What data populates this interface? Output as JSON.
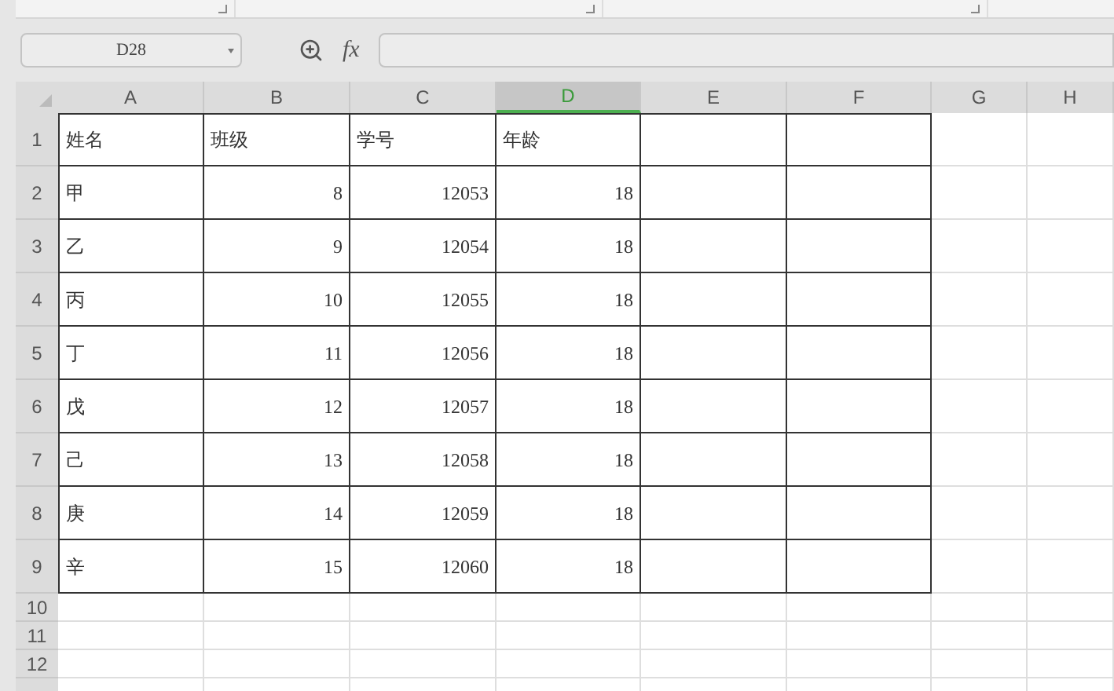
{
  "name_box": {
    "value": "D28"
  },
  "formula_bar": {
    "function_label": "fx"
  },
  "columns": [
    {
      "label": "A",
      "selected": false
    },
    {
      "label": "B",
      "selected": false
    },
    {
      "label": "C",
      "selected": false
    },
    {
      "label": "D",
      "selected": true
    },
    {
      "label": "E",
      "selected": false
    },
    {
      "label": "F",
      "selected": false
    },
    {
      "label": "G",
      "selected": false
    },
    {
      "label": "H",
      "selected": false
    }
  ],
  "rows": [
    {
      "number": "1",
      "cells": [
        {
          "text": "姓名",
          "kind": "text"
        },
        {
          "text": "班级",
          "kind": "text"
        },
        {
          "text": "学号",
          "kind": "text"
        },
        {
          "text": "年龄",
          "kind": "text"
        }
      ]
    },
    {
      "number": "2",
      "cells": [
        {
          "text": "甲",
          "kind": "text"
        },
        {
          "text": "8",
          "kind": "number"
        },
        {
          "text": "12053",
          "kind": "number"
        },
        {
          "text": "18",
          "kind": "number"
        }
      ]
    },
    {
      "number": "3",
      "cells": [
        {
          "text": "乙",
          "kind": "text"
        },
        {
          "text": "9",
          "kind": "number"
        },
        {
          "text": "12054",
          "kind": "number"
        },
        {
          "text": "18",
          "kind": "number"
        }
      ]
    },
    {
      "number": "4",
      "cells": [
        {
          "text": "丙",
          "kind": "text"
        },
        {
          "text": "10",
          "kind": "number"
        },
        {
          "text": "12055",
          "kind": "number"
        },
        {
          "text": "18",
          "kind": "number"
        }
      ]
    },
    {
      "number": "5",
      "cells": [
        {
          "text": "丁",
          "kind": "text"
        },
        {
          "text": "11",
          "kind": "number"
        },
        {
          "text": "12056",
          "kind": "number"
        },
        {
          "text": "18",
          "kind": "number"
        }
      ]
    },
    {
      "number": "6",
      "cells": [
        {
          "text": "戊",
          "kind": "text"
        },
        {
          "text": "12",
          "kind": "number"
        },
        {
          "text": "12057",
          "kind": "number"
        },
        {
          "text": "18",
          "kind": "number"
        }
      ]
    },
    {
      "number": "7",
      "cells": [
        {
          "text": "己",
          "kind": "text"
        },
        {
          "text": "13",
          "kind": "number"
        },
        {
          "text": "12058",
          "kind": "number"
        },
        {
          "text": "18",
          "kind": "number"
        }
      ]
    },
    {
      "number": "8",
      "cells": [
        {
          "text": "庚",
          "kind": "text"
        },
        {
          "text": "14",
          "kind": "number"
        },
        {
          "text": "12059",
          "kind": "number"
        },
        {
          "text": "18",
          "kind": "number"
        }
      ]
    },
    {
      "number": "9",
      "cells": [
        {
          "text": "辛",
          "kind": "text"
        },
        {
          "text": "15",
          "kind": "number"
        },
        {
          "text": "12060",
          "kind": "number"
        },
        {
          "text": "18",
          "kind": "number"
        }
      ]
    }
  ],
  "empty_rows": [
    "10",
    "11",
    "12"
  ]
}
